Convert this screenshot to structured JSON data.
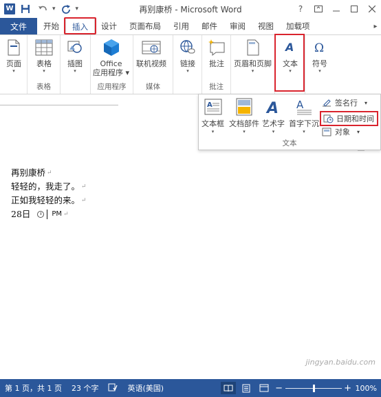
{
  "titlebar": {
    "app_letter": "W",
    "title": "再别康桥 - Microsoft Word",
    "help": "?",
    "qat_dropdown": "▾"
  },
  "tabs": {
    "file": "文件",
    "items": [
      "开始",
      "插入",
      "设计",
      "页面布局",
      "引用",
      "邮件",
      "审阅",
      "视图",
      "加载项"
    ],
    "active_index": 1
  },
  "ribbon": {
    "page_btn": "页面",
    "table_btn": "表格",
    "table_group": "表格",
    "picture_btn": "插图",
    "office_btn_line1": "Office",
    "office_btn_line2": "应用程序",
    "apps_group": "应用程序",
    "video_btn": "联机视频",
    "media_group": "媒体",
    "link_btn": "链接",
    "comment_btn": "批注",
    "comment_group": "批注",
    "header_footer_btn": "页眉和页脚",
    "text_btn": "文本",
    "symbol_btn": "符号"
  },
  "dropdown": {
    "textbox": "文本框",
    "quickparts": "文档部件",
    "wordart": "艺术字",
    "dropcap": "首字下沉",
    "signature": "签名行",
    "datetime": "日期和时间",
    "object": "对象",
    "group_name": "文本"
  },
  "document": {
    "lines": [
      "再别康桥",
      "轻轻的，我走了。",
      "正如我轻轻的来。"
    ],
    "date_day": "28日",
    "date_ampm": "PM"
  },
  "statusbar": {
    "page": "第 1 页，共 1 页",
    "words": "23 个字",
    "language": "英语(美国)",
    "zoom_minus": "−",
    "zoom_plus": "+",
    "zoom": "100%"
  },
  "watermark": "jingyan.baidu.com",
  "colors": {
    "accent": "#2b579a",
    "highlight": "#d9232d"
  }
}
